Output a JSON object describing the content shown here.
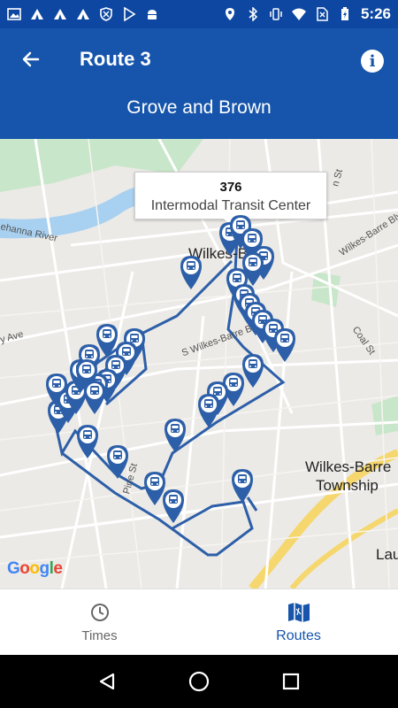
{
  "status_bar": {
    "time": "5:26",
    "left_icons": [
      "gallery-icon",
      "tent-icon",
      "tent-icon",
      "tent-icon",
      "shield-icon",
      "play-store-icon",
      "android-icon"
    ],
    "right_icons": [
      "location-icon",
      "bluetooth-icon",
      "vibrate-icon",
      "wifi-icon",
      "no-sim-icon",
      "battery-charging-icon"
    ]
  },
  "app_bar": {
    "title": "Route 3",
    "subtitle": "Grove and Brown",
    "back_icon": "arrow-back-icon",
    "info_icon": "info-icon",
    "info_glyph": "i"
  },
  "map": {
    "callout": {
      "number": "376",
      "name": "Intermodal Transit Center"
    },
    "labels": {
      "city": "Wilkes-Barre",
      "township": "Wilkes-Barre\nTownship",
      "township_line1": "Wilkes-Barre",
      "township_line2": "Township",
      "lau": "Lau",
      "river": "ehanna River",
      "blvd": "Wilkes-Barre Blvd",
      "s_wb_blvd": "S Wilkes-Barre Blvd",
      "coal_st": "Coal St",
      "ave": "y Ave",
      "n_st": "n St",
      "st": "St",
      "pine": "Pine St"
    },
    "attribution": "Google",
    "route_color": "#2d5fa8"
  },
  "bottom_nav": {
    "items": [
      {
        "label": "Times",
        "icon": "clock-icon",
        "active": false
      },
      {
        "label": "Routes",
        "icon": "map-icon",
        "active": true
      }
    ]
  },
  "system_nav": {
    "icons": [
      "back-triangle-icon",
      "home-circle-icon",
      "recents-square-icon"
    ]
  }
}
